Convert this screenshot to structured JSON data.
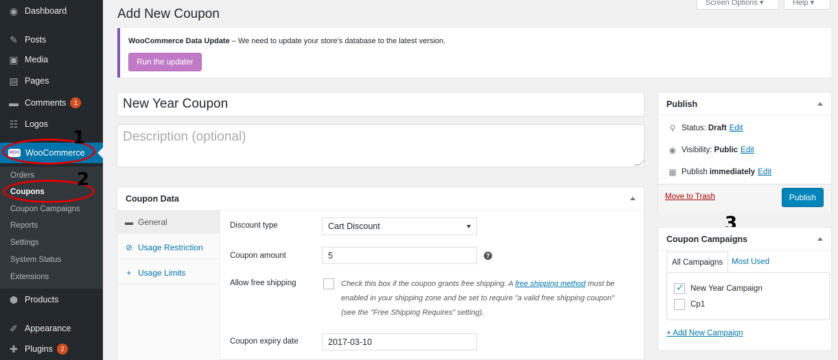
{
  "sidebar": {
    "items": [
      {
        "label": "Dashboard",
        "icon": "dashboard-icon"
      },
      {
        "label": "Posts",
        "icon": "pin-icon"
      },
      {
        "label": "Media",
        "icon": "media-icon"
      },
      {
        "label": "Pages",
        "icon": "pages-icon"
      },
      {
        "label": "Comments",
        "icon": "comments-icon",
        "badge": "1"
      },
      {
        "label": "Logos",
        "icon": "logos-icon"
      },
      {
        "label": "WooCommerce",
        "icon": "woo-icon"
      },
      {
        "label": "Products",
        "icon": "products-icon"
      },
      {
        "label": "Appearance",
        "icon": "brush-icon"
      },
      {
        "label": "Plugins",
        "icon": "plugin-icon",
        "badge": "2"
      }
    ],
    "woo_logo_text": "WOO",
    "submenu": [
      "Orders",
      "Coupons",
      "Coupon Campaigns",
      "Reports",
      "Settings",
      "System Status",
      "Extensions"
    ]
  },
  "annotations": [
    "1",
    "2",
    "3"
  ],
  "header": {
    "title": "Add New Coupon",
    "screen_options": "Screen Options ▾",
    "help": "Help ▾"
  },
  "notice": {
    "bold": "WooCommerce Data Update",
    "text": " – We need to update your store's database to the latest version.",
    "button": "Run the updater"
  },
  "coupon": {
    "title_value": "New Year Coupon",
    "description_placeholder": "Description (optional)"
  },
  "coupon_data": {
    "title": "Coupon Data",
    "tabs": [
      "General",
      "Usage Restriction",
      "Usage Limits"
    ],
    "fields": {
      "discount_type_label": "Discount type",
      "discount_type_value": "Cart Discount",
      "amount_label": "Coupon amount",
      "amount_value": "5",
      "free_shipping_label": "Allow free shipping",
      "free_shipping_text_1": "Check this box if the coupon grants free shipping. A ",
      "free_shipping_link": "free shipping method",
      "free_shipping_text_2": " must be enabled in your shipping zone and be set to require \"a valid free shipping coupon\" (see the \"Free Shipping Requires\" setting).",
      "expiry_label": "Coupon expiry date",
      "expiry_value": "2017-03-10"
    }
  },
  "publish": {
    "title": "Publish",
    "status_label": "Status:",
    "status_value": "Draft",
    "visibility_label": "Visibility:",
    "visibility_value": "Public",
    "publish_label": "Publish",
    "publish_value": "immediately",
    "edit": "Edit",
    "trash": "Move to Trash",
    "button": "Publish"
  },
  "campaigns": {
    "title": "Coupon Campaigns",
    "tab_all": "All Campaigns",
    "tab_most_used": "Most Used",
    "items": [
      {
        "label": "New Year Campaign",
        "checked": true
      },
      {
        "label": "Cp1",
        "checked": false
      }
    ],
    "add_link": "+ Add New Campaign"
  }
}
